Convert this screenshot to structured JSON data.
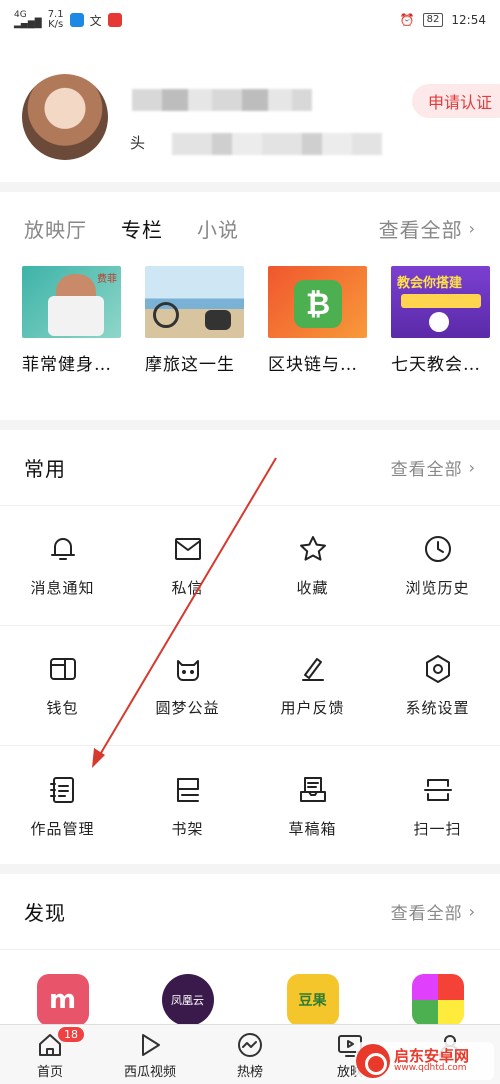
{
  "status_bar": {
    "network": "4G",
    "speed_value": "7.1",
    "speed_unit": "K/s",
    "battery": "82",
    "time": "12:54"
  },
  "profile": {
    "name_prefix": "头",
    "apply_label": "申请认证"
  },
  "content_tabs": {
    "tabs": [
      "放映厅",
      "专栏",
      "小说"
    ],
    "active": "专栏",
    "see_all": "查看全部"
  },
  "books": [
    {
      "title": "菲常健身…",
      "cover_text": "费菲"
    },
    {
      "title": "摩旅这一生",
      "cover_text": ""
    },
    {
      "title": "区块链与…",
      "cover_text": ""
    },
    {
      "title": "七天教会…",
      "cover_text": "教会你搭建"
    }
  ],
  "common": {
    "title": "常用",
    "see_all": "查看全部",
    "items": [
      {
        "label": "消息通知",
        "icon": "bell-icon"
      },
      {
        "label": "私信",
        "icon": "mail-icon"
      },
      {
        "label": "收藏",
        "icon": "star-icon"
      },
      {
        "label": "浏览历史",
        "icon": "clock-icon"
      },
      {
        "label": "钱包",
        "icon": "wallet-icon"
      },
      {
        "label": "圆梦公益",
        "icon": "charity-icon"
      },
      {
        "label": "用户反馈",
        "icon": "feedback-pen-icon"
      },
      {
        "label": "系统设置",
        "icon": "gear-icon"
      },
      {
        "label": "作品管理",
        "icon": "works-list-icon"
      },
      {
        "label": "书架",
        "icon": "bookshelf-icon"
      },
      {
        "label": "草稿箱",
        "icon": "draft-box-icon"
      },
      {
        "label": "扫一扫",
        "icon": "scan-icon"
      }
    ]
  },
  "discover": {
    "title": "发现",
    "see_all": "查看全部",
    "apps": [
      {
        "name": "m-app-icon",
        "color": "#e8556b",
        "label": "m"
      },
      {
        "name": "fenghuang-cloud-icon",
        "color": "#3a1a4a",
        "label": "凤凰云"
      },
      {
        "name": "douguo-icon",
        "color": "#f5c62b",
        "label": "豆果"
      },
      {
        "name": "petal-app-icon",
        "color": "#ffffff",
        "label": ""
      }
    ]
  },
  "bottom_nav": {
    "items": [
      {
        "label": "首页",
        "icon": "home-icon"
      },
      {
        "label": "西瓜视频",
        "icon": "play-icon"
      },
      {
        "label": "热榜",
        "icon": "trending-icon"
      },
      {
        "label": "放映",
        "icon": "screen-icon"
      },
      {
        "label": "",
        "icon": "profile-icon"
      }
    ],
    "home_badge": "18"
  },
  "watermark": {
    "cn": "启东安卓网",
    "en": "www.qdhtd.com"
  },
  "colors": {
    "accent_red": "#e23b3b",
    "annotation_arrow": "#d63a2f"
  }
}
